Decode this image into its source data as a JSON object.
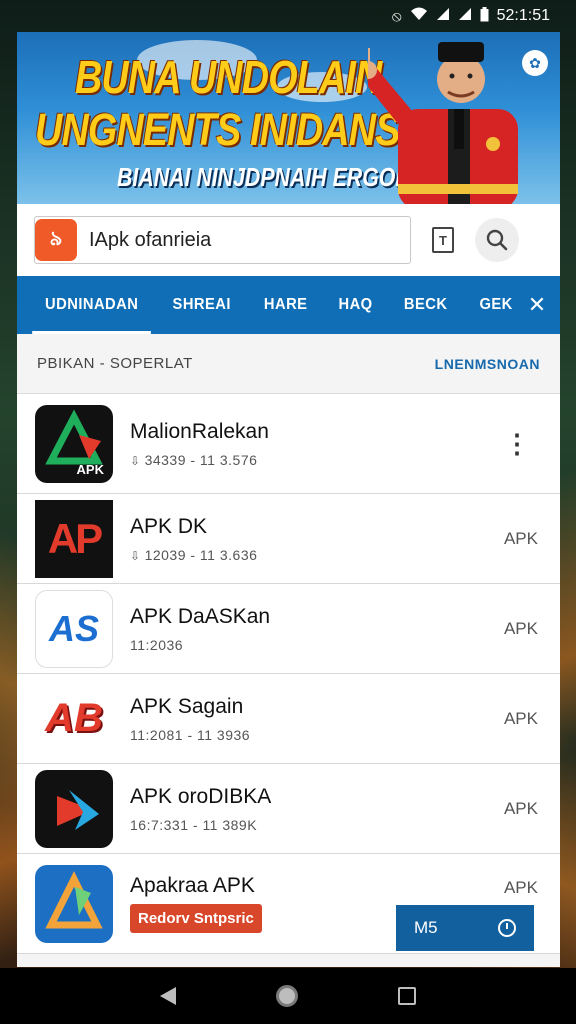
{
  "status_bar": {
    "time": "52:1:51",
    "icons": [
      "vibrate-icon",
      "wifi-icon",
      "signal-icon",
      "signal-icon-2",
      "battery-icon"
    ]
  },
  "banner": {
    "line1": "BUNA UNDOLAIN",
    "line2": "UNGNENTS INIDANSIN",
    "line3": "BIANAI NINJDPNAIH ERGONESII",
    "badge_icon": "settings-icon"
  },
  "search": {
    "logo_text": "৯",
    "value": "IApk ofanrieia",
    "doc_icon_glyph": "T"
  },
  "tabs": [
    {
      "label": "UDNINADAN",
      "active": true
    },
    {
      "label": "SHREAI",
      "active": false
    },
    {
      "label": "HARE",
      "active": false
    },
    {
      "label": "HAQ",
      "active": false
    },
    {
      "label": "BECK",
      "active": false
    },
    {
      "label": "GEK",
      "active": false
    }
  ],
  "section": {
    "left": "PBIKAN - SOPERLAT",
    "right": "LNENMSNOAN"
  },
  "items": [
    {
      "name": "MalionRalekan",
      "meta": "34339 - 11 3.576",
      "right": "⋮",
      "icon_label": "APK",
      "icon_colors": [
        "#111111",
        "#1fae5b",
        "#e23a2b"
      ]
    },
    {
      "name": "APK DK",
      "meta": "12039 - 11 3.636",
      "right": "APK",
      "icon_label": "AP",
      "icon_colors": [
        "#111111",
        "#e23a2b"
      ]
    },
    {
      "name": "APK DaASKan",
      "meta": "11:2036",
      "right": "APK",
      "icon_label": "AS",
      "icon_colors": [
        "#ffffff",
        "#1a8f55",
        "#1c6fd1"
      ]
    },
    {
      "name": "APK Sagain",
      "meta": "11:2081 - 11 3936",
      "right": "APK",
      "icon_label": "AB",
      "icon_colors": [
        "#ffffff",
        "#e23a2b"
      ]
    },
    {
      "name": "APK oroDIBKA",
      "meta": "16:7:331 - 11 389K",
      "right": "APK",
      "icon_label": "▶",
      "icon_colors": [
        "#111111",
        "#e23a2b",
        "#27a8e0"
      ]
    },
    {
      "name": "Apakraa APK",
      "meta": "",
      "right": "APK",
      "icon_label": "A",
      "icon_colors": [
        "#1d6fc4",
        "#f2a33a"
      ],
      "badge": "Redorv Sntpsric"
    }
  ],
  "fab": {
    "label": "M5"
  },
  "nav": [
    "back-button",
    "home-button",
    "recent-apps-button"
  ]
}
